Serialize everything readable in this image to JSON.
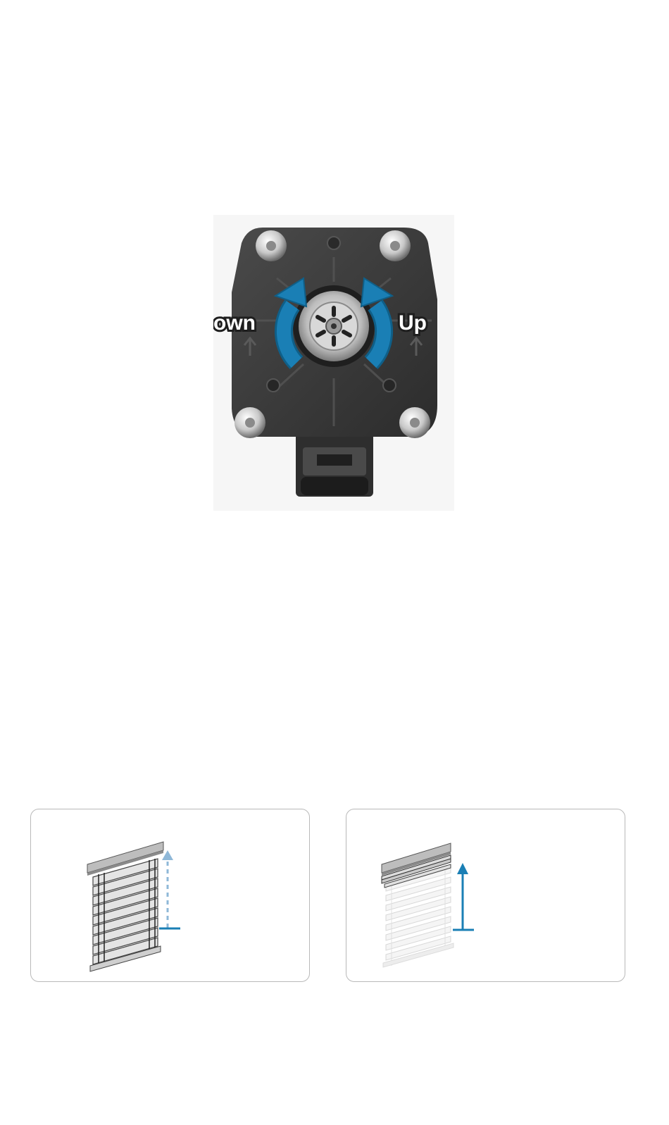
{
  "motor": {
    "label_down": "own",
    "label_up": "Up",
    "arrow_color": "#1a7fb5",
    "housing_color": "#3a3a3a",
    "icons": [
      "rotate-ccw-arrow-icon",
      "rotate-cw-arrow-icon",
      "screw-icon",
      "connector-plug-icon"
    ]
  },
  "panels": [
    {
      "name": "blind-lowered",
      "blind_state": "closed",
      "arrow_style": "dashed",
      "arrow_color": "#8fb8d8",
      "marker_color": "#1a7fb5"
    },
    {
      "name": "blind-raised",
      "blind_state": "raised",
      "arrow_style": "solid",
      "arrow_color": "#1a7fb5",
      "marker_color": "#1a7fb5"
    }
  ]
}
